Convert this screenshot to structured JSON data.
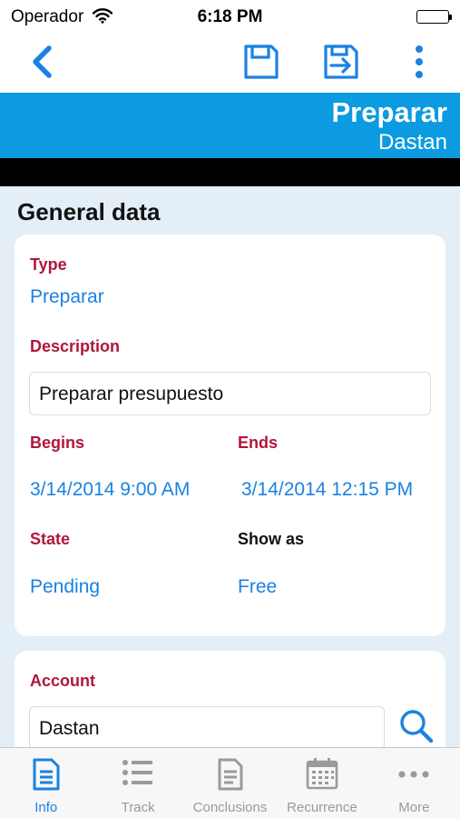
{
  "status_bar": {
    "carrier": "Operador",
    "time": "6:18 PM"
  },
  "header": {
    "title": "Preparar",
    "subtitle": "Dastan"
  },
  "section": {
    "title": "General data"
  },
  "general": {
    "type_label": "Type",
    "type_value": "Preparar",
    "description_label": "Description",
    "description_value": "Preparar presupuesto",
    "begins_label": "Begins",
    "begins_value": "3/14/2014 9:00 AM",
    "ends_label": "Ends",
    "ends_value": "3/14/2014 12:15 PM",
    "state_label": "State",
    "state_value": "Pending",
    "show_as_label": "Show as",
    "show_as_value": "Free"
  },
  "account": {
    "label": "Account",
    "value": "Dastan"
  },
  "tabs": [
    {
      "label": "Info",
      "icon": "document-icon",
      "active": true
    },
    {
      "label": "Track",
      "icon": "list-icon",
      "active": false
    },
    {
      "label": "Conclusions",
      "icon": "notes-icon",
      "active": false
    },
    {
      "label": "Recurrence",
      "icon": "calendar-icon",
      "active": false
    },
    {
      "label": "More",
      "icon": "more-icon",
      "active": false
    }
  ],
  "colors": {
    "accent": "#1a82e2",
    "header_band": "#0c9be0",
    "field_label": "#b0173a",
    "background": "#e4eef6",
    "tab_inactive": "#9a9a9a"
  }
}
